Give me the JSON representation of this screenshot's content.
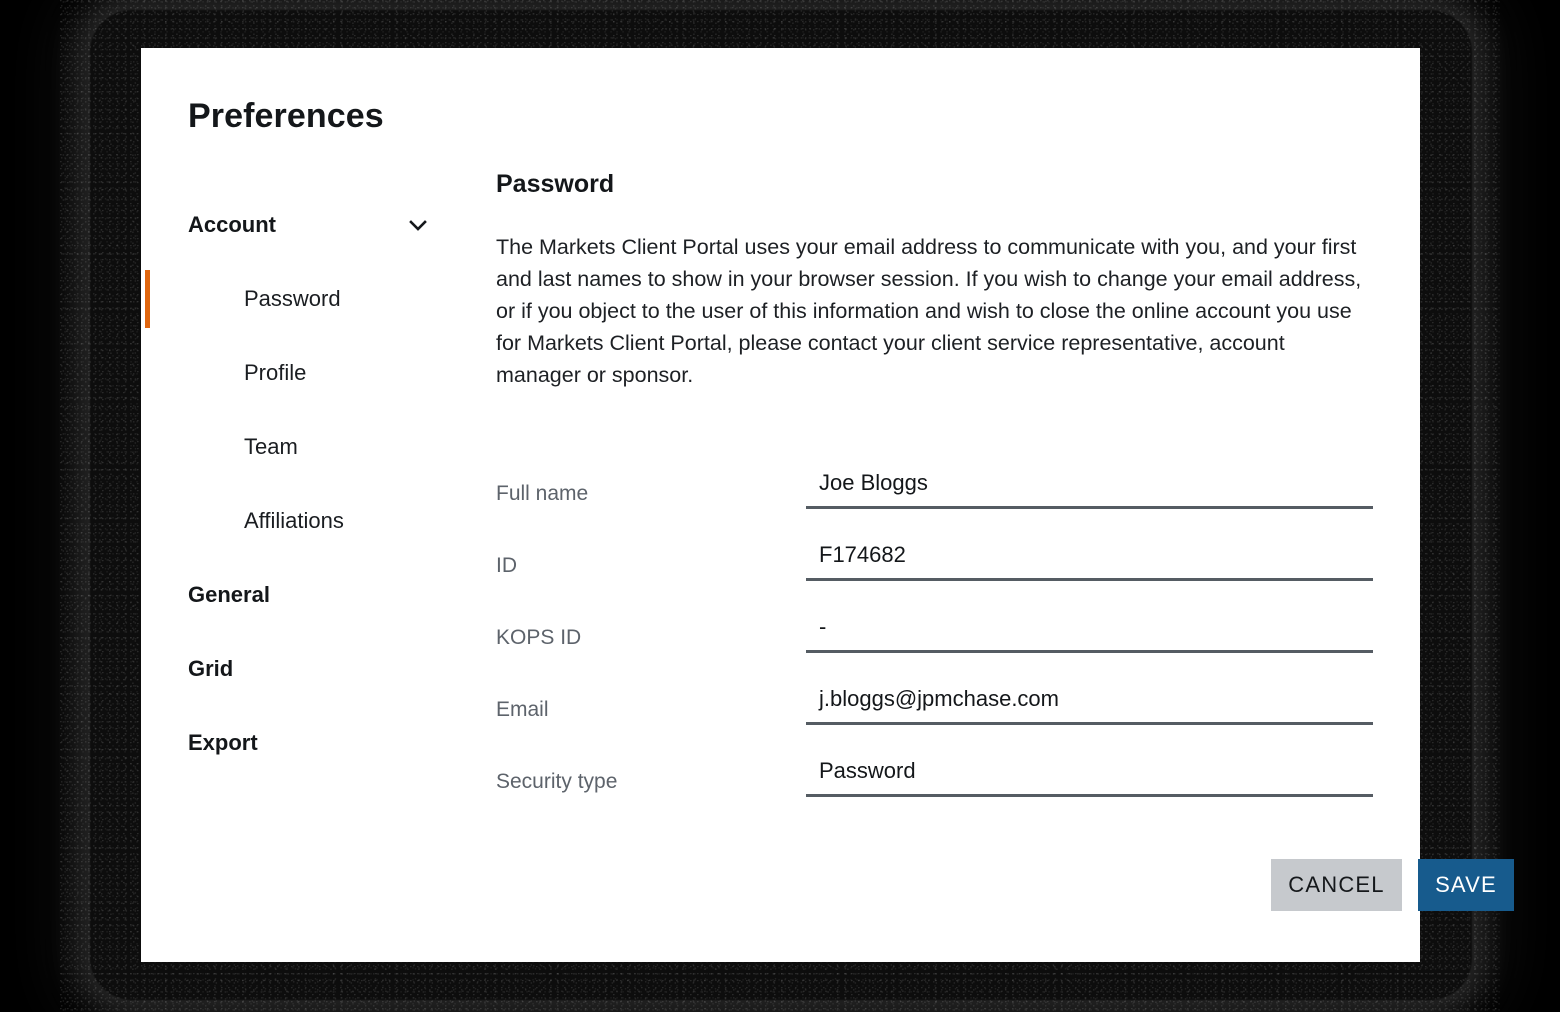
{
  "dialog": {
    "title": "Preferences"
  },
  "sidebar": {
    "groups": [
      {
        "label": "Account",
        "icon": "chevron-down-icon",
        "expanded": true,
        "items": [
          {
            "label": "Password",
            "active": true
          },
          {
            "label": "Profile",
            "active": false
          },
          {
            "label": "Team",
            "active": false
          },
          {
            "label": "Affiliations",
            "active": false
          }
        ]
      }
    ],
    "top_items": [
      {
        "label": "General"
      },
      {
        "label": "Grid"
      },
      {
        "label": "Export"
      }
    ]
  },
  "panel": {
    "section_title": "Password",
    "description": "The Markets Client Portal uses your email address to communicate with you, and your first and last names to show in your browser session. If you wish to change your email address, or if you object to the user of this information and wish to close the online account you use for Markets Client Portal, please contact your client service representative, account manager or sponsor."
  },
  "form": {
    "fields": [
      {
        "label": "Full name",
        "value": "Joe Bloggs"
      },
      {
        "label": "ID",
        "value": "F174682"
      },
      {
        "label": "KOPS ID",
        "value": "-"
      },
      {
        "label": "Email",
        "value": "j.bloggs@jpmchase.com"
      },
      {
        "label": "Security type",
        "value": "Password"
      }
    ]
  },
  "actions": {
    "cancel_label": "CANCEL",
    "save_label": "SAVE"
  },
  "colors": {
    "accent_orange": "#e0660f",
    "save_blue": "#175b8d",
    "cancel_gray": "#c6c9cd",
    "label_gray": "#5d636b",
    "underline_gray": "#555c63",
    "card_white": "#ffffff",
    "backdrop_black": "#000000"
  }
}
